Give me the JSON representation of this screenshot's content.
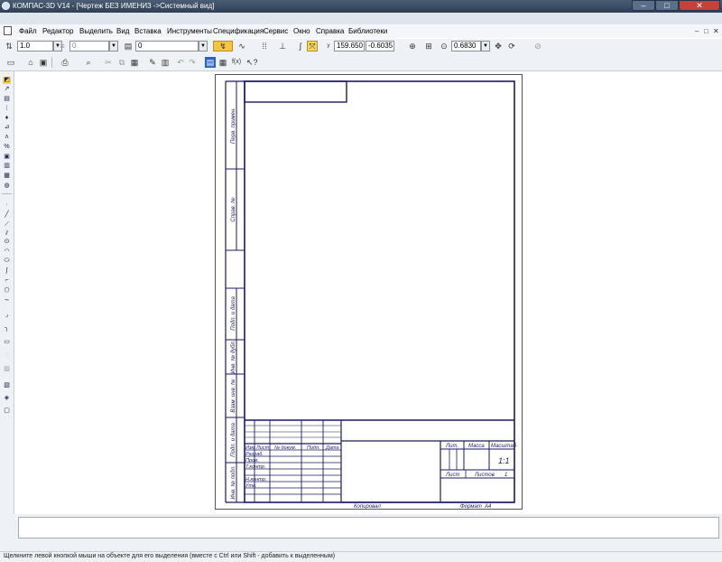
{
  "window": {
    "title": "КОМПАС-3D V14 - [Чертеж БЕЗ ИМЕНИ3 ->Системный вид]",
    "minimize": "–",
    "maximize": "□",
    "close": "✕"
  },
  "menu": {
    "items": [
      "Файл",
      "Редактор",
      "Выделить",
      "Вид",
      "Вставка",
      "Инструменты",
      "Спецификация",
      "Сервис",
      "Окно",
      "Справка",
      "Библиотеки"
    ],
    "doc_controls": [
      "–",
      "□",
      "✕"
    ]
  },
  "toolbar1": {
    "style_value": "1.0",
    "layer_value": "0",
    "view_value": "0",
    "coord_x": "159.650",
    "coord_y": "-0.6035",
    "zoom_value": "0.6830"
  },
  "toolbar2": {
    "fx_label": "f(x)"
  },
  "sheet": {
    "side_labels": [
      "Перв. примен.",
      "Справ. №",
      "Подп. и дата",
      "Инв. № дубл.",
      "Взам. инв. №",
      "Подп. и дата",
      "Инв. № подл."
    ],
    "title_headers": [
      "Изм",
      "Лист",
      "№ докум.",
      "Подп.",
      "Дата"
    ],
    "title_rows": [
      "Разраб.",
      "Пров.",
      "Т.контр.",
      "",
      "Н.контр.",
      "Утв."
    ],
    "lit_label": "Лит.",
    "mass_label": "Масса",
    "scale_label": "Масштаб",
    "scale_value": "1:1",
    "sheet_label": "Лист",
    "sheets_label": "Листов",
    "sheets_value": "1",
    "copied_label": "Копировал",
    "format_label": "Формат",
    "format_value": "A4"
  },
  "status": {
    "hint": "Щелкните левой кнопкой мыши на объекте для его выделения (вместе с Ctrl или Shift - добавить к выделенным)"
  }
}
